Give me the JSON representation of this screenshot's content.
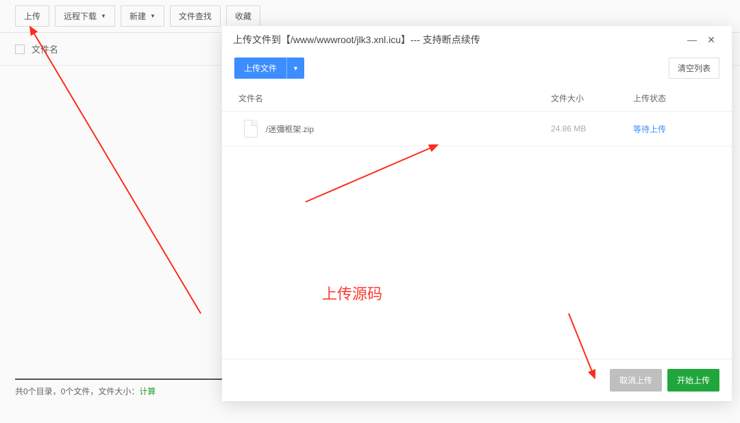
{
  "toolbar": {
    "upload": "上传",
    "remote_download": "远程下载",
    "new": "新建",
    "file_search": "文件查找",
    "favorite": "收藏"
  },
  "file_header": {
    "filename_col": "文件名"
  },
  "status": {
    "text_prefix": "共0个目录，0个文件，文件大小：",
    "calc": "计算"
  },
  "modal": {
    "title": "上传文件到【/www/wwwroot/jlk3.xnl.icu】--- 支持断点续传",
    "upload_file": "上传文件",
    "clear_list": "清空列表",
    "head_name": "文件名",
    "head_size": "文件大小",
    "head_status": "上传状态",
    "row": {
      "name": "/迷彌框架.zip",
      "size": "24.86 MB",
      "status": "等待上传"
    },
    "cancel_upload": "取消上传",
    "start_upload": "开始上传"
  },
  "annotation": {
    "text": "上传源码"
  }
}
